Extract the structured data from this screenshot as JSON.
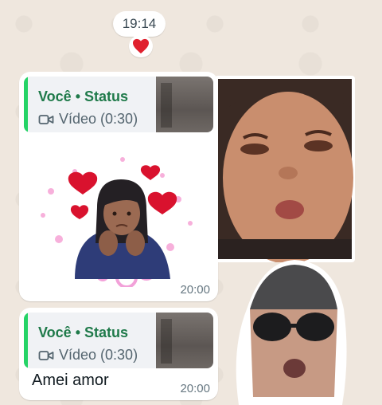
{
  "chat": {
    "date_time": "19:14",
    "reaction_icon": "red-heart-icon"
  },
  "messages": [
    {
      "quote_title": "Você • Status",
      "quote_subtitle": "Vídeo (0:30)",
      "time": "20:00"
    },
    {
      "quote_title": "Você • Status",
      "quote_subtitle": "Vídeo (0:30)",
      "text": "Amei amor",
      "time": "20:00"
    }
  ],
  "colors": {
    "wallpaper": "#efe7de",
    "quote_accent": "#25d366",
    "quote_title": "#1f7a4a",
    "heart": "#e0202e"
  }
}
